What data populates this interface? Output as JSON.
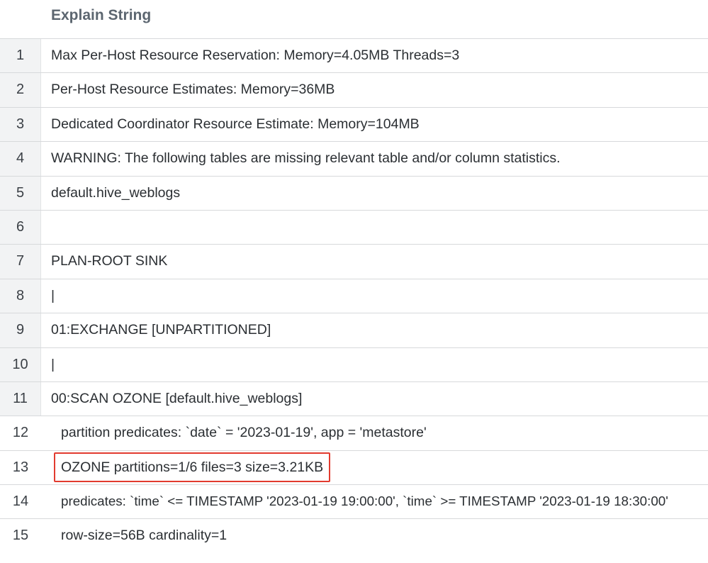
{
  "table": {
    "header": "Explain String",
    "rows": [
      {
        "num": "1",
        "text": "Max Per-Host Resource Reservation: Memory=4.05MB Threads=3"
      },
      {
        "num": "2",
        "text": "Per-Host Resource Estimates: Memory=36MB"
      },
      {
        "num": "3",
        "text": "Dedicated Coordinator Resource Estimate: Memory=104MB"
      },
      {
        "num": "4",
        "text": "WARNING: The following tables are missing relevant table and/or column statistics."
      },
      {
        "num": "5",
        "text": "default.hive_weblogs"
      },
      {
        "num": "6",
        "text": ""
      },
      {
        "num": "7",
        "text": "PLAN-ROOT SINK"
      },
      {
        "num": "8",
        "text": "|"
      },
      {
        "num": "9",
        "text": "01:EXCHANGE [UNPARTITIONED]"
      },
      {
        "num": "10",
        "text": "|"
      },
      {
        "num": "11",
        "text": "00:SCAN OZONE [default.hive_weblogs]"
      },
      {
        "num": "12",
        "text": "partition predicates: `date` = '2023-01-19', app = 'metastore'"
      },
      {
        "num": "13",
        "text": "OZONE partitions=1/6 files=3 size=3.21KB"
      },
      {
        "num": "14",
        "text": "predicates: `time` <= TIMESTAMP '2023-01-19 19:00:00', `time` >= TIMESTAMP '2023-01-19 18:30:00'"
      },
      {
        "num": "15",
        "text": "row-size=56B cardinality=1"
      }
    ]
  },
  "highlight_color": "#e23b2f"
}
